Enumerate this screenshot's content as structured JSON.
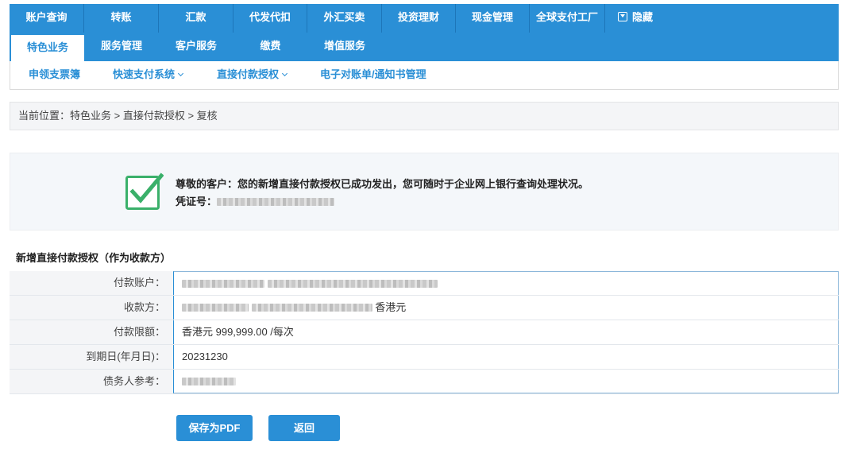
{
  "nav": {
    "row1": [
      "账户查询",
      "转账",
      "汇款",
      "代发代扣",
      "外汇买卖",
      "投资理财",
      "现金管理",
      "全球支付工厂"
    ],
    "hide_label": "隐藏",
    "row2": [
      "特色业务",
      "服务管理",
      "客户服务",
      "缴费",
      "增值服务"
    ],
    "active": "特色业务"
  },
  "subnav": [
    "申领支票簿",
    "快速支付系统",
    "直接付款授权",
    "电子对账单/通知书管理"
  ],
  "breadcrumb": {
    "prefix": "当前位置：",
    "path": "特色业务 > 直接付款授权 > ",
    "current": "复核"
  },
  "notice": {
    "message": "尊敬的客户：您的新增直接付款授权已成功发出，您可随时于企业网上银行查询处理状况。",
    "voucher_label": "凭证号："
  },
  "section_title": "新增直接付款授权（作为收款方）",
  "details": [
    {
      "label": "付款账户：",
      "value": ""
    },
    {
      "label": "收款方：",
      "value": "香港元"
    },
    {
      "label": "付款限额：",
      "value": "香港元 999,999.00 /每次"
    },
    {
      "label": "到期日(年月日)：",
      "value": "20231230"
    },
    {
      "label": "债务人参考：",
      "value": ""
    }
  ],
  "buttons": {
    "save_pdf": "保存为PDF",
    "back": "返回"
  },
  "colors": {
    "primary": "#2a8fd6",
    "success": "#3ab06a"
  }
}
